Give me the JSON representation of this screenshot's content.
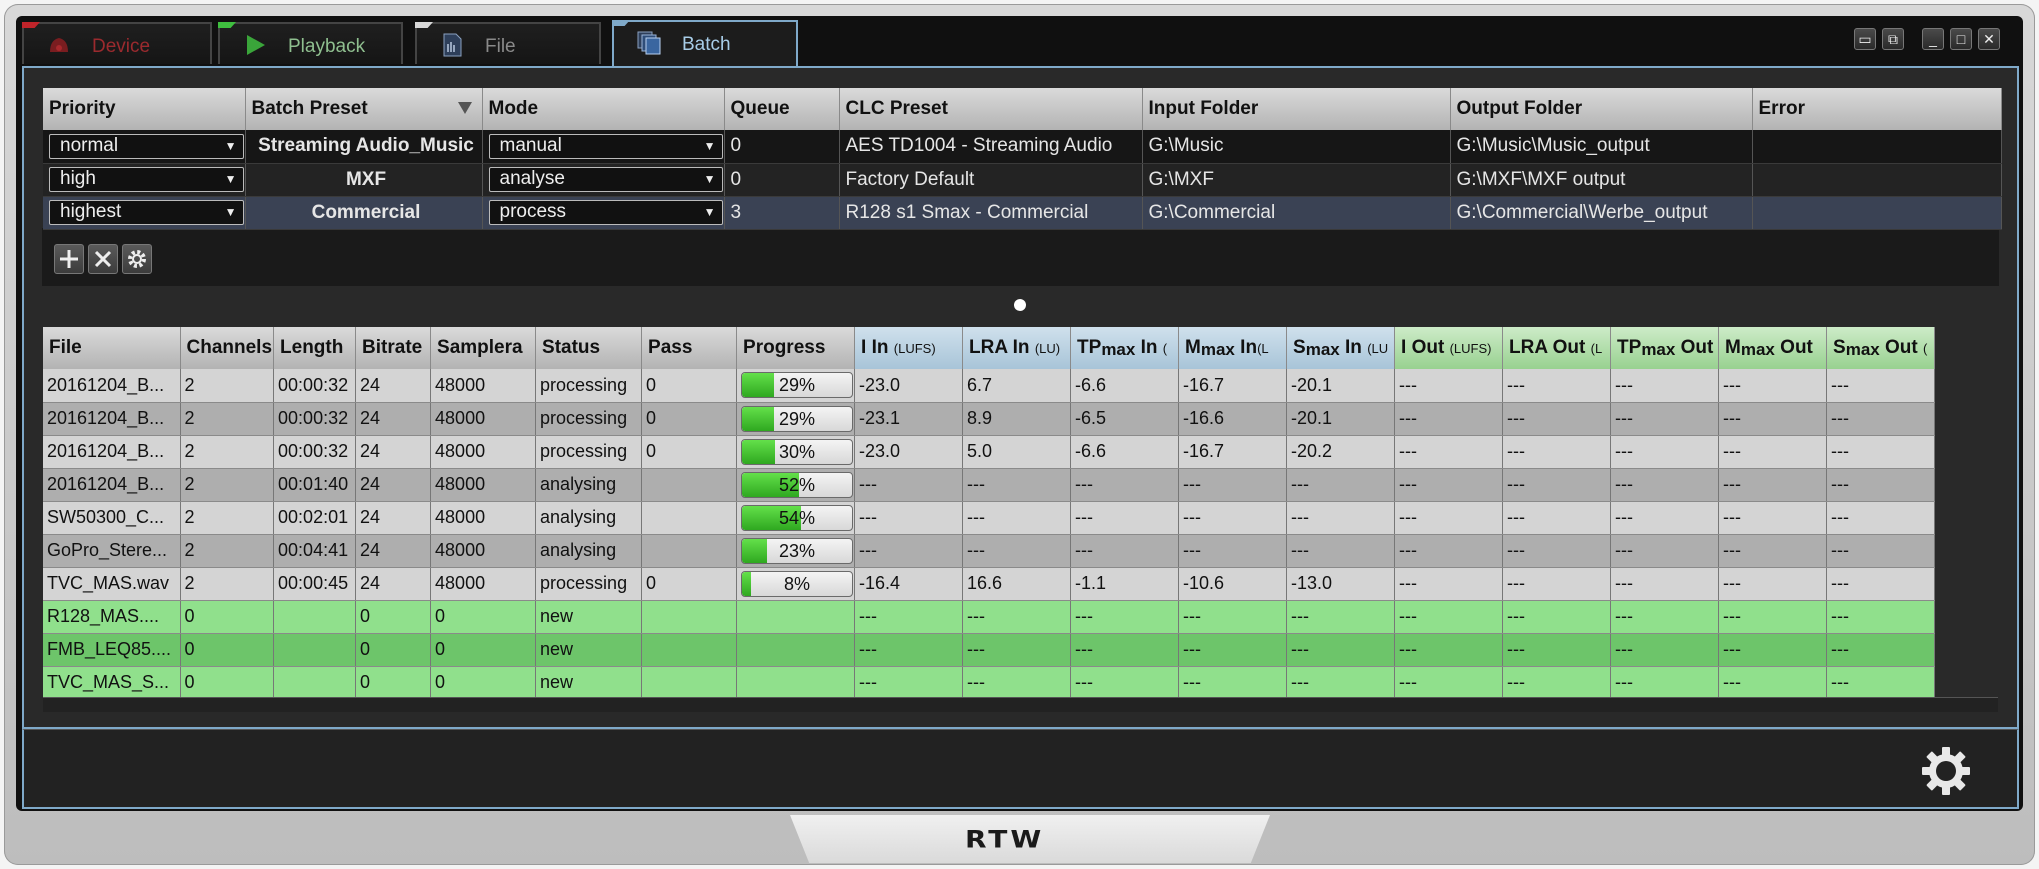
{
  "tabs": [
    {
      "label": "Device",
      "icon": "device-icon",
      "accent": "#c0242a",
      "text_color": "#9b2a2e"
    },
    {
      "label": "Playback",
      "icon": "play-icon",
      "accent": "#3fbf3f",
      "text_color": "#8fbf8f"
    },
    {
      "label": "File",
      "icon": "file-icon",
      "accent": "#d8d8d8",
      "text_color": "#8a8a8a"
    },
    {
      "label": "Batch",
      "icon": "batch-icon",
      "accent": "#7fa9c9",
      "text_color": "#a8cde8"
    }
  ],
  "active_tab": "Batch",
  "window_controls": [
    "restore-small-icon",
    "restore-double-icon",
    "minimize-icon",
    "maximize-icon",
    "close-icon"
  ],
  "batch": {
    "headers": [
      "Priority",
      "Batch Preset",
      "Mode",
      "Queue",
      "CLC Preset",
      "Input Folder",
      "Output Folder",
      "Error"
    ],
    "rows": [
      {
        "priority": "normal",
        "preset": "Streaming Audio_Music",
        "mode": "manual",
        "queue": "0",
        "clc": "AES TD1004 - Streaming Audio",
        "input": "G:\\Music",
        "output": "G:\\Music\\Music_output",
        "error": ""
      },
      {
        "priority": "high",
        "preset": "MXF",
        "mode": "analyse",
        "queue": "0",
        "clc": "Factory Default",
        "input": "G:\\MXF",
        "output": "G:\\MXF\\MXF output",
        "error": ""
      },
      {
        "priority": "highest",
        "preset": "Commercial",
        "mode": "process",
        "queue": "3",
        "clc": "R128 s1 Smax - Commercial",
        "input": "G:\\Commercial",
        "output": "G:\\Commercial\\Werbe_output",
        "error": ""
      }
    ],
    "tools": [
      "add-icon",
      "remove-icon",
      "settings-icon"
    ]
  },
  "files": {
    "headers": {
      "file": "File",
      "channels": "Channels",
      "length": "Length",
      "bitrate": "Bitrate",
      "samplerate": "Samplera",
      "status": "Status",
      "pass": "Pass",
      "progress": "Progress",
      "i_in": "I In",
      "i_in_unit": "(LUFS)",
      "lra_in": "LRA In",
      "lra_in_unit": "(LU)",
      "tp_in_pre": "TP",
      "tp_in_sub": "max",
      "tp_in_post": " In",
      "tp_in_unit": "(",
      "m_in_pre": "M",
      "m_in_sub": "max",
      "m_in_post": " In",
      "m_in_unit": "(L",
      "s_in_pre": "S",
      "s_in_sub": "max",
      "s_in_post": " In",
      "s_in_unit": "(LU",
      "i_out": "I Out",
      "i_out_unit": "(LUFS)",
      "lra_out": "LRA Out",
      "lra_out_unit": "(L",
      "tp_out_pre": "TP",
      "tp_out_sub": "max",
      "tp_out_post": " Out",
      "m_out_pre": "M",
      "m_out_sub": "max",
      "m_out_post": " Out",
      "s_out_pre": "S",
      "s_out_sub": "max",
      "s_out_post": " Out",
      "s_out_unit": "("
    },
    "rows": [
      {
        "file": "20161204_B...",
        "channels": "2",
        "length": "00:00:32",
        "bitrate": "24",
        "samplerate": "48000",
        "status": "processing",
        "pass": "0",
        "progress": 29,
        "progress_label": "29%",
        "i_in": "-23.0",
        "i_in_c": "g",
        "lra_in": "6.7",
        "lra_in_c": "g",
        "tp_in": "-6.6",
        "tp_in_c": "g",
        "m_in": "-16.7",
        "s_in": "-20.1",
        "i_out": "---",
        "lra_out": "---",
        "tp_out": "---",
        "m_out": "---",
        "s_out": "---",
        "kind": "file"
      },
      {
        "file": "20161204_B...",
        "channels": "2",
        "length": "00:00:32",
        "bitrate": "24",
        "samplerate": "48000",
        "status": "processing",
        "pass": "0",
        "progress": 29,
        "progress_label": "29%",
        "i_in": "-23.1",
        "i_in_c": "g",
        "lra_in": "8.9",
        "lra_in_c": "g",
        "tp_in": "-6.5",
        "tp_in_c": "g",
        "m_in": "-16.6",
        "s_in": "-20.1",
        "i_out": "---",
        "lra_out": "---",
        "tp_out": "---",
        "m_out": "---",
        "s_out": "---",
        "kind": "file"
      },
      {
        "file": "20161204_B...",
        "channels": "2",
        "length": "00:00:32",
        "bitrate": "24",
        "samplerate": "48000",
        "status": "processing",
        "pass": "0",
        "progress": 30,
        "progress_label": "30%",
        "i_in": "-23.0",
        "i_in_c": "r",
        "lra_in": "5.0",
        "lra_in_c": "g",
        "tp_in": "-6.6",
        "tp_in_c": "g",
        "m_in": "-16.7",
        "s_in": "-20.2",
        "i_out": "---",
        "lra_out": "---",
        "tp_out": "---",
        "m_out": "---",
        "s_out": "---",
        "kind": "file"
      },
      {
        "file": "20161204_B...",
        "channels": "2",
        "length": "00:01:40",
        "bitrate": "24",
        "samplerate": "48000",
        "status": "analysing",
        "pass": "",
        "progress": 52,
        "progress_label": "52%",
        "i_in": "---",
        "i_in_c": "",
        "lra_in": "---",
        "lra_in_c": "",
        "tp_in": "---",
        "tp_in_c": "",
        "m_in": "---",
        "s_in": "---",
        "i_out": "---",
        "lra_out": "---",
        "tp_out": "---",
        "m_out": "---",
        "s_out": "---",
        "kind": "file"
      },
      {
        "file": "SW50300_C...",
        "channels": "2",
        "length": "00:02:01",
        "bitrate": "24",
        "samplerate": "48000",
        "status": "analysing",
        "pass": "",
        "progress": 54,
        "progress_label": "54%",
        "i_in": "---",
        "i_in_c": "",
        "lra_in": "---",
        "lra_in_c": "",
        "tp_in": "---",
        "tp_in_c": "",
        "m_in": "---",
        "s_in": "---",
        "i_out": "---",
        "lra_out": "---",
        "tp_out": "---",
        "m_out": "---",
        "s_out": "---",
        "kind": "file"
      },
      {
        "file": "GoPro_Stere...",
        "channels": "2",
        "length": "00:04:41",
        "bitrate": "24",
        "samplerate": "48000",
        "status": "analysing",
        "pass": "",
        "progress": 23,
        "progress_label": "23%",
        "i_in": "---",
        "i_in_c": "",
        "lra_in": "---",
        "lra_in_c": "",
        "tp_in": "---",
        "tp_in_c": "",
        "m_in": "---",
        "s_in": "---",
        "i_out": "---",
        "lra_out": "---",
        "tp_out": "---",
        "m_out": "---",
        "s_out": "---",
        "kind": "file"
      },
      {
        "file": "TVC_MAS.wav",
        "channels": "2",
        "length": "00:00:45",
        "bitrate": "24",
        "samplerate": "48000",
        "status": "processing",
        "pass": "0",
        "progress": 8,
        "progress_label": "8%",
        "i_in": "-16.4",
        "i_in_c": "r",
        "lra_in": "16.6",
        "lra_in_c": "r",
        "tp_in": "-1.1",
        "tp_in_c": "g",
        "m_in": "-10.6",
        "s_in": "-13.0",
        "i_out": "---",
        "lra_out": "---",
        "tp_out": "---",
        "m_out": "---",
        "s_out": "---",
        "kind": "file"
      },
      {
        "file": "R128_MAS....",
        "channels": "0",
        "length": "",
        "bitrate": "0",
        "samplerate": "0",
        "status": "new",
        "pass": "",
        "progress": null,
        "progress_label": "",
        "i_in": "---",
        "i_in_c": "",
        "lra_in": "---",
        "lra_in_c": "",
        "tp_in": "---",
        "tp_in_c": "",
        "m_in": "---",
        "s_in": "---",
        "i_out": "---",
        "lra_out": "---",
        "tp_out": "---",
        "m_out": "---",
        "s_out": "---",
        "kind": "new"
      },
      {
        "file": "FMB_LEQ85....",
        "channels": "0",
        "length": "",
        "bitrate": "0",
        "samplerate": "0",
        "status": "new",
        "pass": "",
        "progress": null,
        "progress_label": "",
        "i_in": "---",
        "i_in_c": "",
        "lra_in": "---",
        "lra_in_c": "",
        "tp_in": "---",
        "tp_in_c": "",
        "m_in": "---",
        "s_in": "---",
        "i_out": "---",
        "lra_out": "---",
        "tp_out": "---",
        "m_out": "---",
        "s_out": "---",
        "kind": "new"
      },
      {
        "file": "TVC_MAS_S...",
        "channels": "0",
        "length": "",
        "bitrate": "0",
        "samplerate": "0",
        "status": "new",
        "pass": "",
        "progress": null,
        "progress_label": "",
        "i_in": "---",
        "i_in_c": "",
        "lra_in": "---",
        "lra_in_c": "",
        "tp_in": "---",
        "tp_in_c": "",
        "m_in": "---",
        "s_in": "---",
        "i_out": "---",
        "lra_out": "---",
        "tp_out": "---",
        "m_out": "---",
        "s_out": "---",
        "kind": "new"
      }
    ]
  },
  "settings_icon": "gear-icon",
  "brand": "RTW"
}
